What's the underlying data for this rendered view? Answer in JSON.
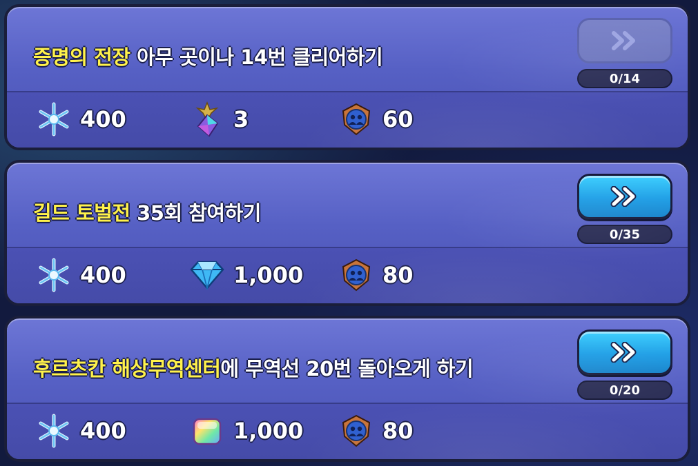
{
  "missions": [
    {
      "title_highlight": "증명의 전장",
      "title_rest": " 아무 곳이나 14번 클리어하기",
      "progress": "0/14",
      "button_state": "disabled",
      "rewards": [
        {
          "icon": "snowflake-icon",
          "value": "400"
        },
        {
          "icon": "star-crystal-icon",
          "value": "3"
        },
        {
          "icon": "guild-medal-icon",
          "value": "60"
        }
      ]
    },
    {
      "title_highlight": "길드 토벌전",
      "title_rest": " 35회 참여하기",
      "progress": "0/35",
      "button_state": "active",
      "rewards": [
        {
          "icon": "snowflake-icon",
          "value": "400"
        },
        {
          "icon": "diamond-gem-icon",
          "value": "1,000"
        },
        {
          "icon": "guild-medal-icon",
          "value": "80"
        }
      ]
    },
    {
      "title_highlight": "후르츠칸 해상무역센터",
      "title_rest": "에 무역선 20번 돌아오게 하기",
      "progress": "0/20",
      "button_state": "active",
      "rewards": [
        {
          "icon": "snowflake-icon",
          "value": "400"
        },
        {
          "icon": "rainbow-cube-icon",
          "value": "1,000"
        },
        {
          "icon": "guild-medal-icon",
          "value": "80"
        }
      ]
    }
  ],
  "colors": {
    "highlight_text": "#fff24a",
    "panel": "#5660c4",
    "button_active": "#1f9fe6"
  }
}
